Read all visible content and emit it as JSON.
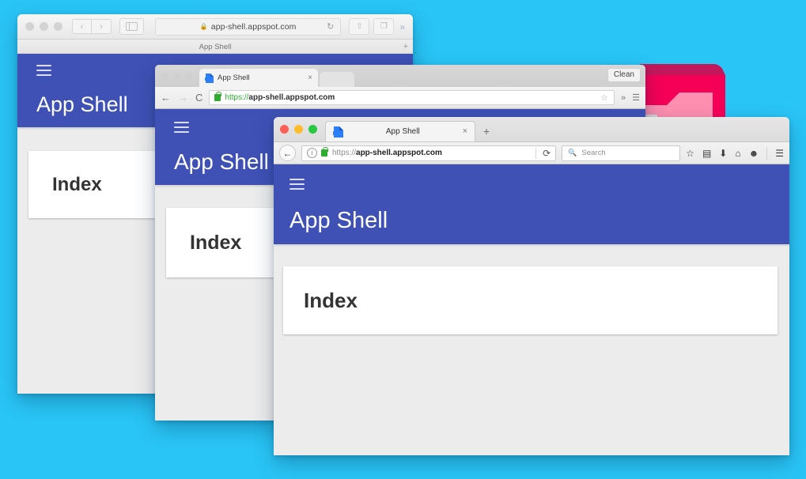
{
  "background": {
    "color": "#29c5f6",
    "decoration": {
      "name": "pink-cube-shape",
      "colors": [
        "#f50057",
        "#c2185b",
        "#ff8fb1",
        "#e0e0e0"
      ]
    }
  },
  "theme": {
    "app_bar_color": "#3f51b5",
    "card_color": "#ffffff",
    "page_background": "#ececec"
  },
  "app": {
    "title": "App Shell",
    "menu_icon": "hamburger-menu-icon",
    "card_title": "Index"
  },
  "safari_window": {
    "name": "Safari",
    "traffic_lights": [
      "close",
      "minimize",
      "zoom"
    ],
    "back_label": "‹",
    "forward_label": "›",
    "sidebar_icon": "sidebar-toggle-icon",
    "lock_icon": "lock-icon",
    "url": "app-shell.appspot.com",
    "reload_icon": "↻",
    "share_icon": "share-icon",
    "tabs_icon": "tabs-overview-icon",
    "more_icon": "»",
    "tab_title": "App Shell",
    "new_tab_label": "+"
  },
  "chrome_window": {
    "name": "Chrome",
    "traffic_lights": [
      "close",
      "minimize",
      "zoom"
    ],
    "tab_title": "App Shell",
    "tab_close_label": "×",
    "clean_button_label": "Clean",
    "back_label": "←",
    "forward_label": "→",
    "reload_label": "C",
    "url_protocol": "https://",
    "url_host": "app-shell.appspot.com",
    "bookmark_icon": "star-icon",
    "more_icon": "»",
    "menu_icon": "hamburger-menu-icon"
  },
  "firefox_window": {
    "name": "Firefox",
    "traffic_lights": [
      "close",
      "minimize",
      "zoom"
    ],
    "tab_title": "App Shell",
    "tab_close_label": "×",
    "new_tab_label": "+",
    "back_label": "←",
    "info_label": "i",
    "lock_icon": "lock-icon",
    "url_protocol": "https://",
    "url_host": "app-shell.appspot.com",
    "reload_label": "⟳",
    "search_placeholder": "Search",
    "search_icon": "search-icon",
    "toolbar_icons": [
      {
        "name": "bookmark-star-icon",
        "glyph": "☆"
      },
      {
        "name": "library-icon",
        "glyph": "▤"
      },
      {
        "name": "downloads-icon",
        "glyph": "⬇"
      },
      {
        "name": "home-icon",
        "glyph": "⌂"
      },
      {
        "name": "sync-account-icon",
        "glyph": "☻"
      },
      {
        "name": "hamburger-menu-icon",
        "glyph": "☰"
      }
    ]
  }
}
